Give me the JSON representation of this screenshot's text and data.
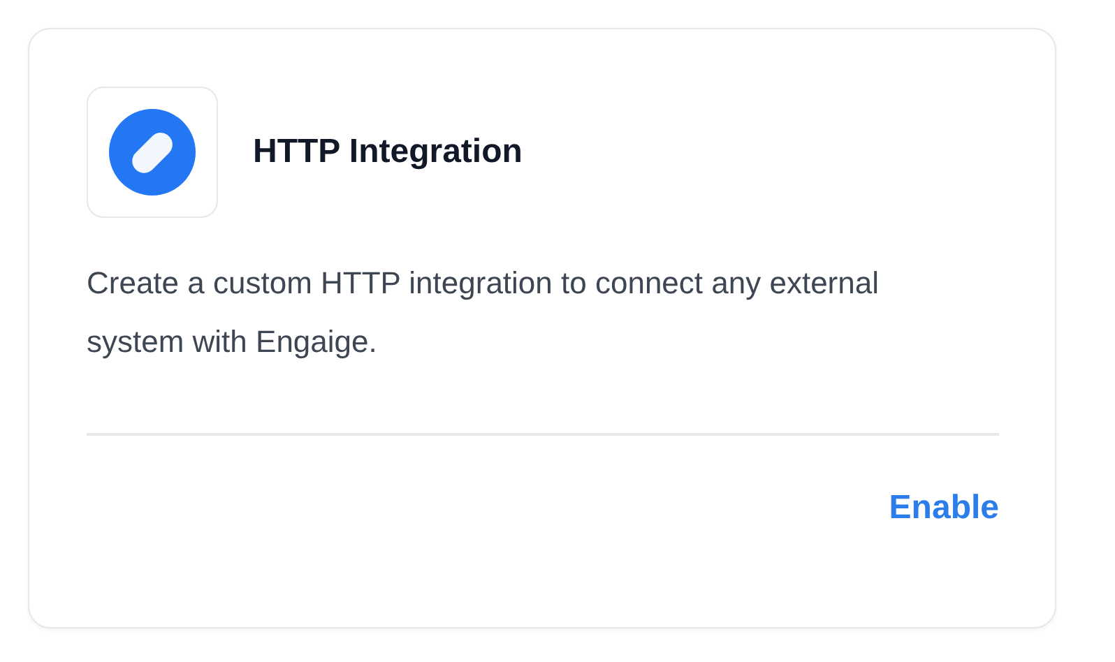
{
  "card": {
    "title": "HTTP Integration",
    "description": "Create a custom HTTP integration to connect any external system with Engaige.",
    "action": "Enable"
  }
}
